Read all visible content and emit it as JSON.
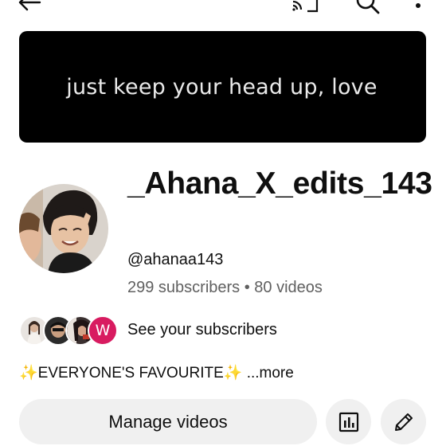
{
  "banner": {
    "text": "just keep your head up, love"
  },
  "channel": {
    "name": "_Ahana_X_edits_143",
    "handle": "@ahanaa143",
    "stats": "299 subscribers • 80 videos"
  },
  "subscribers": {
    "label": "See your subscribers",
    "last_avatar_letter": "W"
  },
  "description": {
    "text": "✨EVERYONE'S FAVOURITE✨",
    "more_label": " ...more"
  },
  "actions": {
    "manage_label": "Manage videos"
  },
  "icons": {
    "back": "arrow-left-icon",
    "cast": "cast-icon",
    "search": "search-icon",
    "more": "more-vert-icon",
    "analytics": "analytics-icon",
    "edit": "pencil-icon"
  },
  "colors": {
    "banner_bg": "#000000",
    "button_bg": "#f0f0f0",
    "secondary_text": "#606060",
    "subscriber_badge": "#d81b60"
  }
}
